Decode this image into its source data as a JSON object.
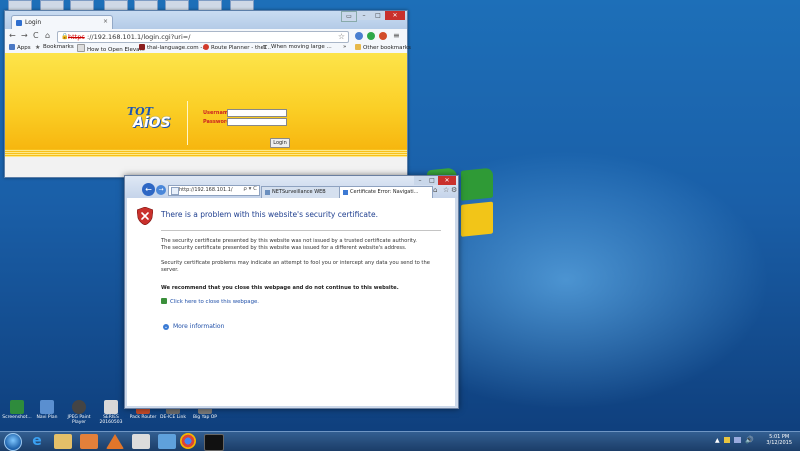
{
  "colors": {
    "desktop_blue": "#1a5fa8",
    "aios_yellow": "#fbcf26",
    "error_title_blue": "#1f3f8f",
    "link_blue": "#1f4fa8",
    "close_red": "#c9302c"
  },
  "chrome": {
    "tab_title": "Login",
    "url_scheme": "https",
    "url_rest": "://192.168.101.1/login.cgi?uri=/",
    "bookmarks": [
      {
        "label": "Apps",
        "icon": "apps-grid-icon"
      },
      {
        "label": "Bookmarks",
        "icon": "star-icon"
      },
      {
        "label": "How to Open Eleva...",
        "icon": "page-icon"
      },
      {
        "label": "thai-language.com -...",
        "icon": "page-icon"
      },
      {
        "label": "Route Planner - the ...",
        "icon": "route-icon"
      },
      {
        "label": "When moving large ...",
        "icon": "times-icon"
      }
    ],
    "other_bookmarks": "Other bookmarks",
    "more_bookmarks": "»"
  },
  "login_page": {
    "logo_top": "TOT",
    "logo_bottom": "AiOS",
    "username_label": "Username",
    "password_label": "Password",
    "login_button": "Login"
  },
  "ie": {
    "address": "http://192.168.101.1/",
    "address_controls": "ρ ▾ C",
    "tabs": [
      {
        "label": "NETSurveillance WEB"
      },
      {
        "label": "Certificate Error: Navigati...",
        "active": true
      }
    ],
    "error_title": "There is a problem with this website's security certificate.",
    "paragraph1": "The security certificate presented by this website was not issued by a trusted certificate authority.",
    "paragraph2": "The security certificate presented by this website was issued for a different website's address.",
    "paragraph3": "Security certificate problems may indicate an attempt to fool you or intercept any data you send to the server.",
    "recommendation": "We recommend that you close this webpage and do not continue to this website.",
    "close_link": "Click here to close this webpage.",
    "more_info": "More information"
  },
  "desktop_icons": [
    {
      "label": "Screenshot..."
    },
    {
      "label": "Navi Plan"
    },
    {
      "label": "JPEG Paint Player"
    },
    {
      "label": "SERIES 20160503"
    },
    {
      "label": "Pack Router"
    },
    {
      "label": "DE-ICE Link"
    },
    {
      "label": "Big Yap OP"
    }
  ],
  "taskbar": {
    "clock_time": "5:01 PM",
    "clock_date": "3/12/2015"
  }
}
